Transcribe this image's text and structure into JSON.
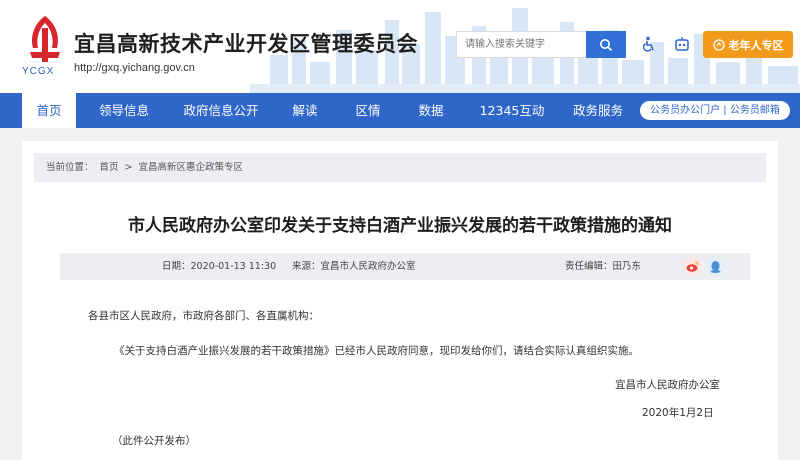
{
  "header": {
    "logo_caption": "YCGX",
    "site_title": "宜昌高新技术产业开发区管理委员会",
    "site_url": "http://gxq.yichang.gov.cn",
    "search_placeholder": "请输入搜索关键字",
    "elder_button_label": "老年人专区",
    "icons": [
      "accessibility-icon",
      "robot-icon",
      "search-icon",
      "elder-icon"
    ]
  },
  "nav": {
    "items": [
      "首页",
      "领导信息",
      "政府信息公开",
      "解读",
      "区情",
      "数据",
      "12345互动",
      "政务服务"
    ],
    "active_index": 0,
    "quick_links": "公务员办公门户 | 公务员邮箱"
  },
  "breadcrumb": {
    "label": "当前位置：",
    "home": "首页",
    "separator": ">",
    "current": "宜昌高新区惠企政策专区"
  },
  "article": {
    "title": "市人民政府办公室印发关于支持白酒产业振兴发展的若干政策措施的通知",
    "date_label": "日期：",
    "date": "2020-01-13 11:30",
    "source_label": "来源：",
    "source": "宜昌市人民政府办公室",
    "editor_label": "责任编辑：",
    "editor": "田乃东",
    "salutation": "各县市区人民政府，市政府各部门、各直属机构：",
    "paragraph": "《关于支持白酒产业振兴发展的若干政策措施》已经市人民政府同意，现印发给你们，请结合实际认真组织实施。",
    "signature": "宜昌市人民政府办公室",
    "sign_date": "2020年1月2日",
    "publish_note": "（此件公开发布）"
  },
  "colors": {
    "nav_blue": "#2f66c9",
    "elder_orange": "#f29a1c",
    "logo_red": "#d7262d",
    "weibo_red": "#e5483c",
    "qq_blue": "#4a90d9"
  }
}
